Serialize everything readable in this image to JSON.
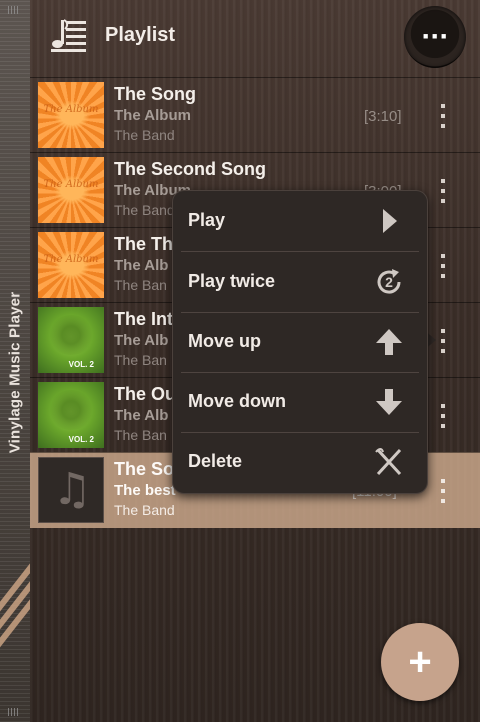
{
  "sidebar": {
    "title": "Vinylage Music Player"
  },
  "header": {
    "title": "Playlist",
    "overflow_label": "···"
  },
  "songs": [
    {
      "title": "The Song",
      "album": "The Album",
      "artist": "The Band",
      "duration": "[3:10]",
      "art": "sun",
      "art_text": "The Album"
    },
    {
      "title": "The Second Song",
      "album": "The Album",
      "artist": "The Band",
      "duration": "[3:00]",
      "art": "sun",
      "art_text": "The Album"
    },
    {
      "title": "The Th",
      "album": "The Alb",
      "artist": "The Ban",
      "duration": "",
      "art": "sun",
      "art_text": "The Album"
    },
    {
      "title": "The Int",
      "album": "The Alb",
      "artist": "The Ban",
      "duration": "",
      "art": "green",
      "art_text": "VOL. 2"
    },
    {
      "title": "The Ou",
      "album": "The Alb",
      "artist": "The Ban",
      "duration": "",
      "art": "green",
      "art_text": "VOL. 2"
    },
    {
      "title": "The So",
      "album": "The best",
      "artist": "The Band",
      "duration": "[11:00]",
      "art": "note",
      "art_text": ""
    }
  ],
  "menu": {
    "items": [
      {
        "label": "Play",
        "icon": "play-icon"
      },
      {
        "label": "Play twice",
        "icon": "repeat-twice-icon",
        "badge": "2"
      },
      {
        "label": "Move up",
        "icon": "arrow-up-icon"
      },
      {
        "label": "Move down",
        "icon": "arrow-down-icon"
      },
      {
        "label": "Delete",
        "icon": "delete-icon"
      }
    ]
  },
  "fab": {
    "label": "+"
  },
  "colors": {
    "accent": "#c6a38c",
    "selected_row": "#cdaa8c",
    "menu_bg": "#2e2825"
  }
}
